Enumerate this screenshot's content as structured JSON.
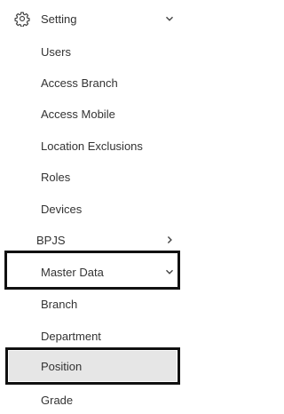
{
  "menu": {
    "setting": {
      "label": "Setting",
      "icon": "gear-icon",
      "expanded": true
    },
    "setting_items": [
      {
        "label": "Users"
      },
      {
        "label": "Access Branch"
      },
      {
        "label": "Access Mobile"
      },
      {
        "label": "Location Exclusions"
      },
      {
        "label": "Roles"
      },
      {
        "label": "Devices"
      }
    ],
    "bpjs": {
      "label": "BPJS",
      "expanded": false
    },
    "master_data": {
      "label": "Master Data",
      "expanded": true
    },
    "master_items": [
      {
        "label": "Branch"
      },
      {
        "label": "Department"
      },
      {
        "label": "Position",
        "selected": true
      },
      {
        "label": "Grade"
      }
    ]
  },
  "colors": {
    "text": "#333333",
    "selected_bg": "#e6e6e6",
    "annotation_border": "#111111"
  }
}
